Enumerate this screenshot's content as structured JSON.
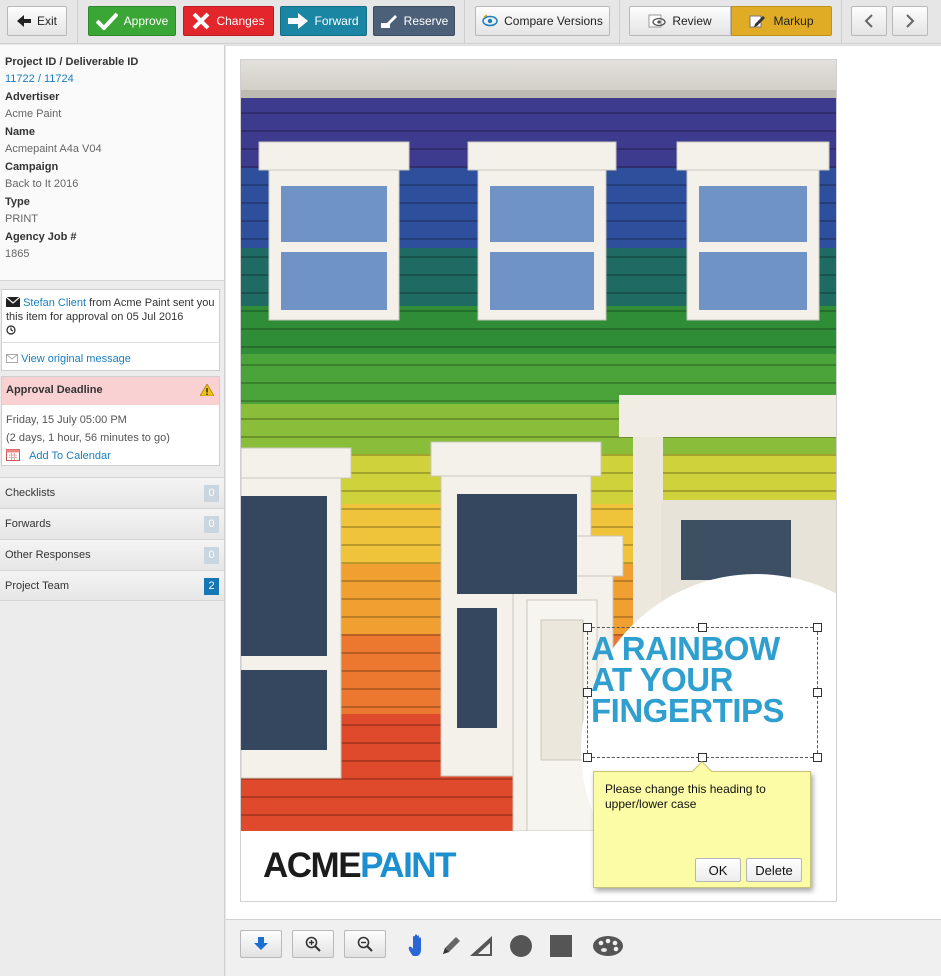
{
  "toolbar": {
    "exit": "Exit",
    "approve": "Approve",
    "changes": "Changes",
    "forward": "Forward",
    "reserve": "Reserve",
    "compare": "Compare Versions",
    "review": "Review",
    "markup": "Markup"
  },
  "details": {
    "project_label": "Project ID / Deliverable ID",
    "project_id": "11722",
    "project_sep": " / ",
    "deliverable_id": "11724",
    "advertiser_label": "Advertiser",
    "advertiser": "Acme Paint",
    "name_label": "Name",
    "name": "Acmepaint A4a V04",
    "campaign_label": "Campaign",
    "campaign": "Back to It 2016",
    "type_label": "Type",
    "type": "PRINT",
    "job_label": "Agency Job #",
    "job": "1865"
  },
  "message": {
    "sender": "Stefan Client",
    "text": " from Acme Paint sent you this item for approval on 05 Jul 2016",
    "link": "View original message"
  },
  "deadline": {
    "title": "Approval Deadline",
    "date": "Friday, 15 July 05:00 PM",
    "remaining": "(2 days, 1 hour, 56 minutes to go)",
    "calendar": "Add To Calendar"
  },
  "accordion": [
    {
      "label": "Checklists",
      "count": "0"
    },
    {
      "label": "Forwards",
      "count": "0"
    },
    {
      "label": "Other Responses",
      "count": "0"
    },
    {
      "label": "Project Team",
      "count": "2"
    }
  ],
  "artwork": {
    "headline": "A Rainbow at your fingertips",
    "logo_left": "ACME",
    "logo_right": "PAINT"
  },
  "note": {
    "text": "Please change this heading to upper/lower case",
    "ok": "OK",
    "delete": "Delete"
  },
  "colors": {
    "approve": "#3aa635",
    "changes": "#e2262b",
    "forward": "#1b86a4",
    "reserve": "#4d6079",
    "markup_active": "#e0ac25",
    "headline": "#2f9fd0",
    "link": "#1a7fbf"
  },
  "icons": [
    "back-arrow-icon",
    "check-icon",
    "x-icon",
    "forward-arrow-icon",
    "reserve-icon",
    "compare-eye-icon",
    "review-eye-icon",
    "markup-pencil-icon",
    "chevron-left-icon",
    "chevron-right-icon",
    "download-icon",
    "zoom-in-icon",
    "zoom-out-icon",
    "hand-icon",
    "pencil-icon",
    "ruler-icon",
    "circle-icon",
    "square-icon",
    "palette-icon"
  ]
}
